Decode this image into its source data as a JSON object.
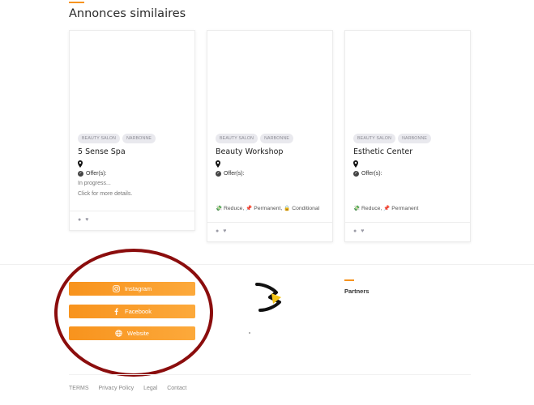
{
  "section_title": "Annonces similaires",
  "cards": [
    {
      "tags": [
        "BEAUTY SALON",
        "NARBONNE"
      ],
      "title": "5 Sense Spa",
      "offers_label": "Offer(s):",
      "status_line": "In progress...",
      "details_line": "Click for more details.",
      "perks": ""
    },
    {
      "tags": [
        "BEAUTY SALON",
        "NARBONNE"
      ],
      "title": "Beauty Workshop",
      "offers_label": "Offer(s):",
      "perks_parts": [
        "Reduce",
        "Permanent",
        "Conditional"
      ]
    },
    {
      "tags": [
        "BEAUTY SALON",
        "NARBONNE"
      ],
      "title": "Esthetic Center",
      "offers_label": "Offer(s):",
      "perks_parts": [
        "Reduce",
        "Permanent"
      ]
    }
  ],
  "social": {
    "instagram": "Instagram",
    "facebook": "Facebook",
    "website": "Website"
  },
  "partners_title": "Partners",
  "footer_links": [
    "TERMS",
    "Privacy Policy",
    "Legal",
    "Contact"
  ],
  "colors": {
    "accent": "#f7931e",
    "annotation_oval": "#8b0d0d"
  },
  "icons": [
    "map-pin-icon",
    "check-circle-icon",
    "chat-icon",
    "heart-icon",
    "instagram-icon",
    "facebook-icon",
    "globe-icon"
  ]
}
